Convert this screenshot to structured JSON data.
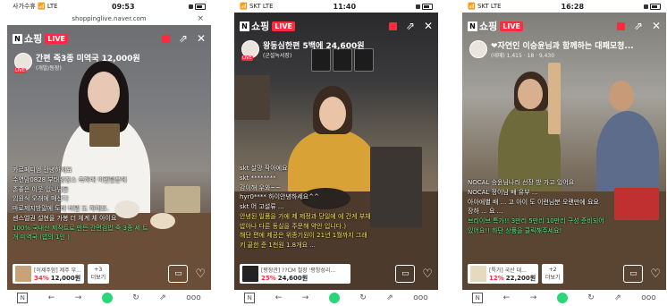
{
  "phones": [
    {
      "status": {
        "left": "사가수휴 📶 LTE",
        "time": "09:53"
      },
      "url": "shoppinglive.naver.com",
      "brand": "쇼핑",
      "live": "LIVE",
      "host": {
        "title": "간편 죽3종 미역국 12,000원",
        "sub": "(개발/동장)"
      },
      "comments": [
        {
          "text": "카르페디엠 안녕하세요",
          "color": "white"
        },
        {
          "text": "수연맘0828 부태명칭스 축하배 이렌탈분에",
          "color": "white"
        },
        {
          "text": "존좋은 이웃 있나님들",
          "color": "white"
        },
        {
          "text": "임원식 오래에 매산다",
          "color": "white"
        },
        {
          "text": "마로제지방말에 도바 비밀 도 하데요.",
          "color": "white"
        },
        {
          "text": "센스엘권 설현을 가봉 더 체계 체 아이요",
          "color": "white"
        },
        {
          "text": "100% 국내산 제작트로 만든 간편검밥 죽 3종 세 트",
          "color": "green"
        },
        {
          "text": "개 미역국 (밥의 1인 )",
          "color": "green"
        }
      ],
      "product": {
        "name": "[이제주함] 제주 부...",
        "discount": "34%",
        "price": "12,000원"
      },
      "more": {
        "count": "+3",
        "label": "더보기"
      },
      "nav": [
        "N",
        "←",
        "→",
        "",
        "↻",
        "⇗",
        "ooo"
      ]
    },
    {
      "status": {
        "left": "📶 SKT LTE",
        "time": "11:40"
      },
      "url": "",
      "brand": "쇼핑",
      "live": "LIVE",
      "host": {
        "title": "왕동심한편 5백에 24,600원",
        "sub": "(군설녹서장)"
      },
      "comments": [
        {
          "text": "skt 살망 작아에요",
          "color": "white"
        },
        {
          "text": "skt ********",
          "color": "white"
        },
        {
          "text": "감이해 우와~~",
          "color": "white"
        },
        {
          "text": "hyr0**** 하이안녕하세요^^",
          "color": "white"
        },
        {
          "text": "skt 어 고설류 ...",
          "color": "white"
        },
        {
          "text": "안녕된 일품을 가에 제 제정과 당일에 에 간게 부채",
          "color": "yellow"
        },
        {
          "text": "밥아나 다른 동실을 주문해 약안 입니다.)",
          "color": "yellow"
        },
        {
          "text": "해단 편에 제공은 위종기원이 21년 1월까지 그래",
          "color": "yellow"
        },
        {
          "text": "키 끝한 준 1천원 1.8개요 ...",
          "color": "yellow"
        }
      ],
      "product": {
        "name": "[평장관] ??CM 철장 '평창성리...",
        "discount": "25%",
        "price": "24,600원"
      },
      "more": {
        "count": "",
        "label": ""
      },
      "nav": [
        "N",
        "←",
        "→",
        "",
        "↻",
        "⇗",
        "ooo"
      ]
    },
    {
      "status": {
        "left": "📶 SKT LTE",
        "time": "16:28"
      },
      "url": "",
      "brand": "쇼핑",
      "live": "LIVE",
      "host": {
        "title": "❤자연인 이승윤님과 함께하는 대패모청...",
        "sub": "(네메)  1,415 · 18 · 9,430"
      },
      "comments": [
        {
          "text": "NOCAL 승윤님나라 선장 방 가고 있어요",
          "color": "white"
        },
        {
          "text": "NOCAL 정이님 배 유부 ...",
          "color": "white"
        },
        {
          "text": "아아에별 배 ... 고 아이 도 이런님분 오랜만에 요요",
          "color": "white"
        },
        {
          "text": "장하 ... 요 ...",
          "color": "white"
        },
        {
          "text": "브리이브 특가!! 3만리 5만리 10만리 구성 준비되어",
          "color": "green"
        },
        {
          "text": "있어요!! 하단 상품을 클릭해주세요!",
          "color": "green"
        }
      ],
      "product": {
        "name": "[특가] 국산 대...",
        "discount": "12%",
        "price": "22,200원"
      },
      "more": {
        "count": "+2",
        "label": "더보기"
      },
      "nav": [
        "N",
        "←",
        "→",
        "",
        "↻",
        "⇗",
        "ooo"
      ]
    }
  ]
}
